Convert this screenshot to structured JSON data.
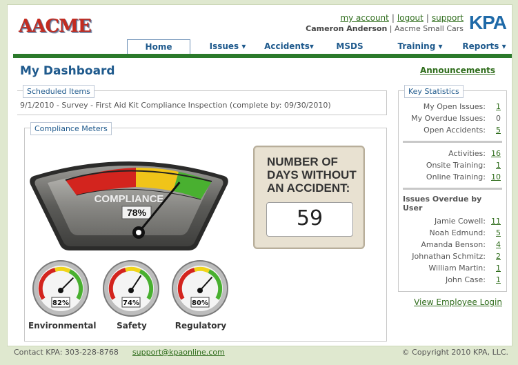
{
  "header": {
    "logo_text": "AACME",
    "links": [
      "my account",
      "logout",
      "support"
    ],
    "user_name": "Cameron Anderson",
    "company": "Aacme Small Cars",
    "brand": "KPA"
  },
  "nav": {
    "tabs": [
      {
        "label": "Home"
      },
      {
        "label": "Issues ▾"
      },
      {
        "label": "Accidents▾"
      },
      {
        "label": "MSDS"
      },
      {
        "label": "Training ▾"
      },
      {
        "label": "Reports ▾"
      }
    ]
  },
  "page": {
    "title": "My Dashboard",
    "announcements": "Announcements"
  },
  "scheduled": {
    "label": "Scheduled Items",
    "item": "9/1/2010 - Survey - First Aid Kit Compliance Inspection (complete by: 09/30/2010)"
  },
  "compliance": {
    "label": "Compliance Meters",
    "main_label": "COMPLIANCE",
    "main_value": "78%",
    "main_level": 0.78,
    "gauges": [
      {
        "label": "Environmental",
        "value": "82%",
        "level": 0.82
      },
      {
        "label": "Safety",
        "value": "74%",
        "level": 0.74
      },
      {
        "label": "Regulatory",
        "value": "80%",
        "level": 0.8
      }
    ]
  },
  "days": {
    "title_line1": "NUMBER OF",
    "title_line2": "DAYS WITHOUT",
    "title_line3": "AN ACCIDENT:",
    "value": "59"
  },
  "key_stats": {
    "label": "Key Statistics",
    "group1": [
      {
        "label": "My Open Issues:",
        "value": "1",
        "link": true
      },
      {
        "label": "My Overdue Issues:",
        "value": "0",
        "link": false
      },
      {
        "label": "Open Accidents:",
        "value": "5",
        "link": true
      }
    ],
    "group2": [
      {
        "label": "Activities:",
        "value": "16",
        "link": true
      },
      {
        "label": "Onsite Training:",
        "value": "1",
        "link": true
      },
      {
        "label": "Online Training:",
        "value": "10",
        "link": true
      }
    ],
    "overdue_title": "Issues Overdue by User",
    "group3": [
      {
        "label": "Jamie Cowell:",
        "value": "11",
        "link": true
      },
      {
        "label": "Noah Edmund:",
        "value": "5",
        "link": true
      },
      {
        "label": "Amanda Benson:",
        "value": "4",
        "link": true
      },
      {
        "label": "Johnathan Schmitz:",
        "value": "2",
        "link": true
      },
      {
        "label": "William Martin:",
        "value": "1",
        "link": true
      },
      {
        "label": "John Case:",
        "value": "1",
        "link": true
      }
    ],
    "view_login": "View Employee Login"
  },
  "footer": {
    "contact": "Contact KPA: 303-228-8768",
    "email": "support@kpaonline.com",
    "copyright": "© Copyright 2010 KPA, LLC."
  },
  "colors": {
    "accent": "#1f5a8d",
    "link": "#2f6d1c",
    "navbar": "#2b7a2b"
  }
}
